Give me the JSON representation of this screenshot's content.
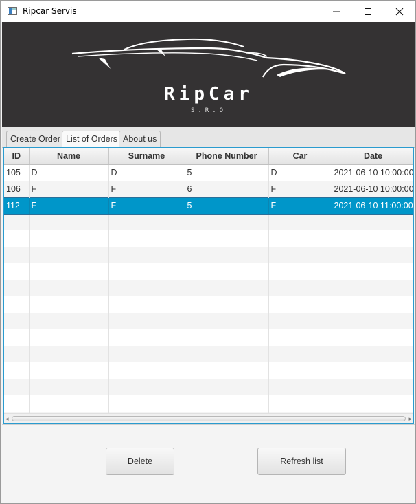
{
  "window": {
    "title": "Ripcar Servis"
  },
  "banner": {
    "logo_text": "RipCar",
    "logo_sub": "S.R.O"
  },
  "tabs": [
    {
      "label": "Create Order",
      "active": false
    },
    {
      "label": "List of Orders",
      "active": true
    },
    {
      "label": "About us",
      "active": false
    }
  ],
  "table": {
    "columns": [
      "ID",
      "Name",
      "Surname",
      "Phone Number",
      "Car",
      "Date"
    ],
    "rows": [
      {
        "id": "105",
        "name": "D",
        "surname": "D",
        "phone": "5",
        "car": "D",
        "date": "2021-06-10 10:00:00"
      },
      {
        "id": "106",
        "name": "F",
        "surname": "F",
        "phone": "6",
        "car": "F",
        "date": "2021-06-10 10:00:00"
      },
      {
        "id": "112",
        "name": "F",
        "surname": "F",
        "phone": "5",
        "car": "F",
        "date": "2021-06-10 11:00:00"
      }
    ],
    "selected_row_index": 2
  },
  "buttons": {
    "delete_label": "Delete",
    "refresh_label": "Refresh list"
  },
  "colors": {
    "banner_bg": "#343233",
    "selection": "#0096c9",
    "table_focus_border": "#2a9bcf"
  },
  "icons": {
    "app": "app-icon",
    "minimize": "minimize-icon",
    "maximize": "maximize-icon",
    "close": "close-icon",
    "scroll_left": "chevron-left-icon",
    "scroll_right": "chevron-right-icon"
  }
}
